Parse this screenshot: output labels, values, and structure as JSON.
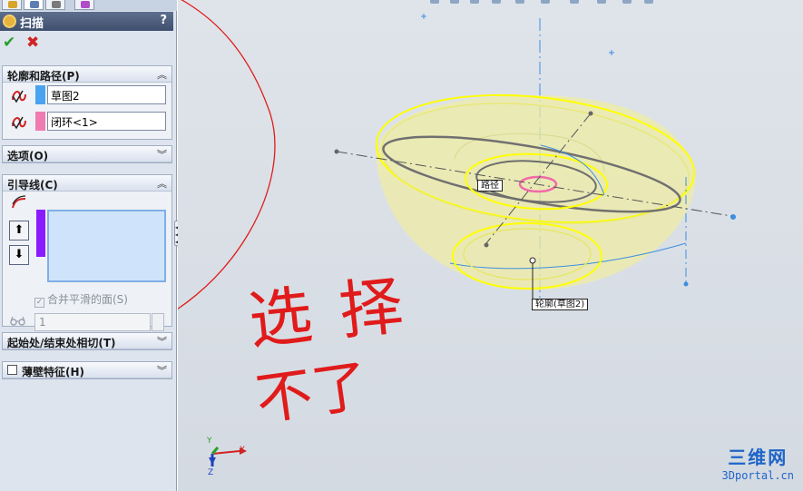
{
  "panel": {
    "title": "扫描",
    "help": "?",
    "ok_icon": "check-icon",
    "cancel_icon": "close-icon",
    "groups": {
      "profile_path": {
        "title": "轮廓和路径(P)",
        "profile_value": "草图2",
        "profile_color": "#4aa3f0",
        "path_value": "闭环<1>",
        "path_color": "#f07bb0"
      },
      "options": {
        "title": "选项(O)"
      },
      "guides": {
        "title": "引导线(C)",
        "list_color": "#8a1bff",
        "up_label": "⬆",
        "down_label": "⬇",
        "merge_label": "合并平滑的面(S)",
        "count_value": "1"
      },
      "tangency": {
        "title": "起始处/结束处相切(T)"
      },
      "thin": {
        "title": "薄壁特征(H)"
      }
    }
  },
  "viewport": {
    "path_tag": "路径",
    "profile_tag": "轮廓(草图2)",
    "annotation_line1": "选 择",
    "annotation_line2": "不了",
    "axis_x": "X",
    "axis_y": "Y",
    "axis_z": "Z",
    "watermark_big": "三维网",
    "watermark_small": "3Dportal.cn",
    "colors": {
      "highlight": "#ffff00",
      "centerline": "#3b8fe0",
      "annotation": "#e01b1b"
    }
  }
}
